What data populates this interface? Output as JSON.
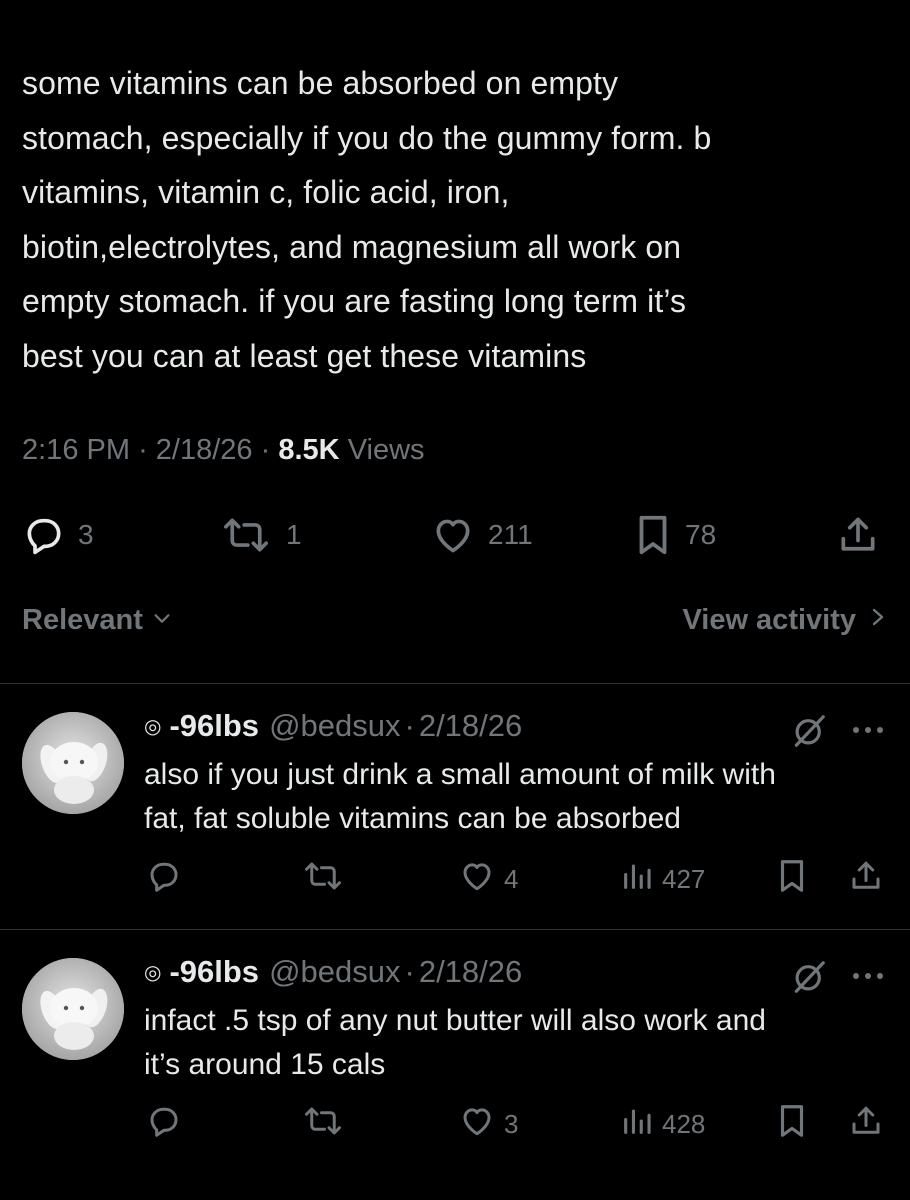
{
  "main_tweet": {
    "lines": [
      "some vitamins can be absorbed on empty",
      "stomach, especially if you do the gummy form. b",
      "vitamins, vitamin c, folic acid, iron,",
      "biotin,electrolytes, and magnesium all work on",
      "empty stomach. if you are fasting long term it’s",
      "best you can at least get these vitamins"
    ],
    "time": "2:16 PM",
    "date": "2/18/26",
    "separator": "·",
    "views_count": "8.5K",
    "views_label": "Views",
    "replies": "3",
    "reposts": "1",
    "likes": "211",
    "bookmarks": "78"
  },
  "sort": {
    "label": "Relevant",
    "view_activity": "View activity"
  },
  "replies": [
    {
      "spiral": "◎",
      "display_name": "-96lbs",
      "handle": "@bedsux",
      "separator": "·",
      "date": "2/18/26",
      "lines": [
        "also if you just drink a small amount of milk with",
        "fat, fat soluble vitamins can be absorbed"
      ],
      "likes": "4",
      "views": "427"
    },
    {
      "spiral": "◎",
      "display_name": "-96lbs",
      "handle": "@bedsux",
      "separator": "·",
      "date": "2/18/26",
      "lines": [
        "infact .5 tsp of any nut butter will also work and",
        "it’s around 15 cals"
      ],
      "likes": "3",
      "views": "428"
    }
  ],
  "icons": {
    "reply": "reply-icon",
    "repost": "repost-icon",
    "like": "heart-icon",
    "bookmark": "bookmark-icon",
    "share": "share-icon",
    "views": "views-chart-icon",
    "grok": "grok-icon",
    "more": "more-icon",
    "chevron_down": "chevron-down-icon",
    "chevron_right": "chevron-right-icon"
  },
  "colors": {
    "background": "#000000",
    "text_primary": "#e7e9ea",
    "text_secondary": "#71767b",
    "divider": "#2f3336"
  }
}
